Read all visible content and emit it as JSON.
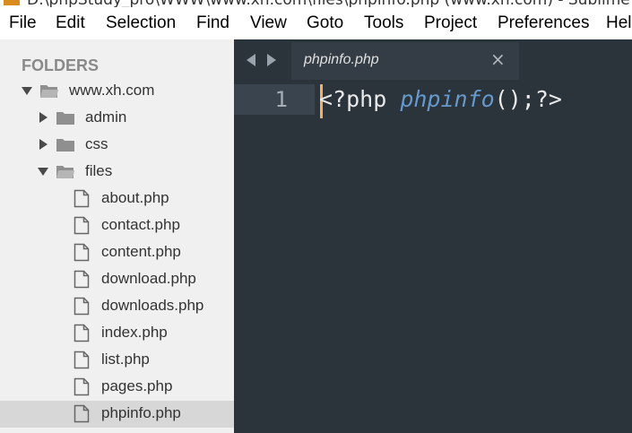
{
  "window": {
    "title": "D:\\phpStudy_pro\\WWW\\www.xh.com\\files\\phpinfo.php (www.xh.com) - Sublime Text"
  },
  "menu": [
    "File",
    "Edit",
    "Selection",
    "Find",
    "View",
    "Goto",
    "Tools",
    "Project",
    "Preferences",
    "Help"
  ],
  "sidebar": {
    "heading": "FOLDERS",
    "tree": [
      {
        "label": "www.xh.com",
        "type": "folder",
        "expanded": true
      },
      {
        "label": "admin",
        "type": "folder",
        "expanded": false
      },
      {
        "label": "css",
        "type": "folder",
        "expanded": false
      },
      {
        "label": "files",
        "type": "folder",
        "expanded": true
      },
      {
        "label": "about.php",
        "type": "file"
      },
      {
        "label": "contact.php",
        "type": "file"
      },
      {
        "label": "content.php",
        "type": "file"
      },
      {
        "label": "download.php",
        "type": "file"
      },
      {
        "label": "downloads.php",
        "type": "file"
      },
      {
        "label": "index.php",
        "type": "file"
      },
      {
        "label": "list.php",
        "type": "file"
      },
      {
        "label": "pages.php",
        "type": "file"
      },
      {
        "label": "phpinfo.php",
        "type": "file",
        "selected": true
      }
    ]
  },
  "editor": {
    "tab": {
      "label": "phpinfo.php",
      "close": "×"
    },
    "line_number": "1",
    "code": {
      "open": "<?php ",
      "fn": "phpinfo",
      "call": "();",
      "close": "?>"
    }
  },
  "colors": {
    "editor_bg": "#2b333b",
    "sidebar_bg": "#f0f0f0",
    "caret": "#f9ae58",
    "function": "#6699cc"
  }
}
